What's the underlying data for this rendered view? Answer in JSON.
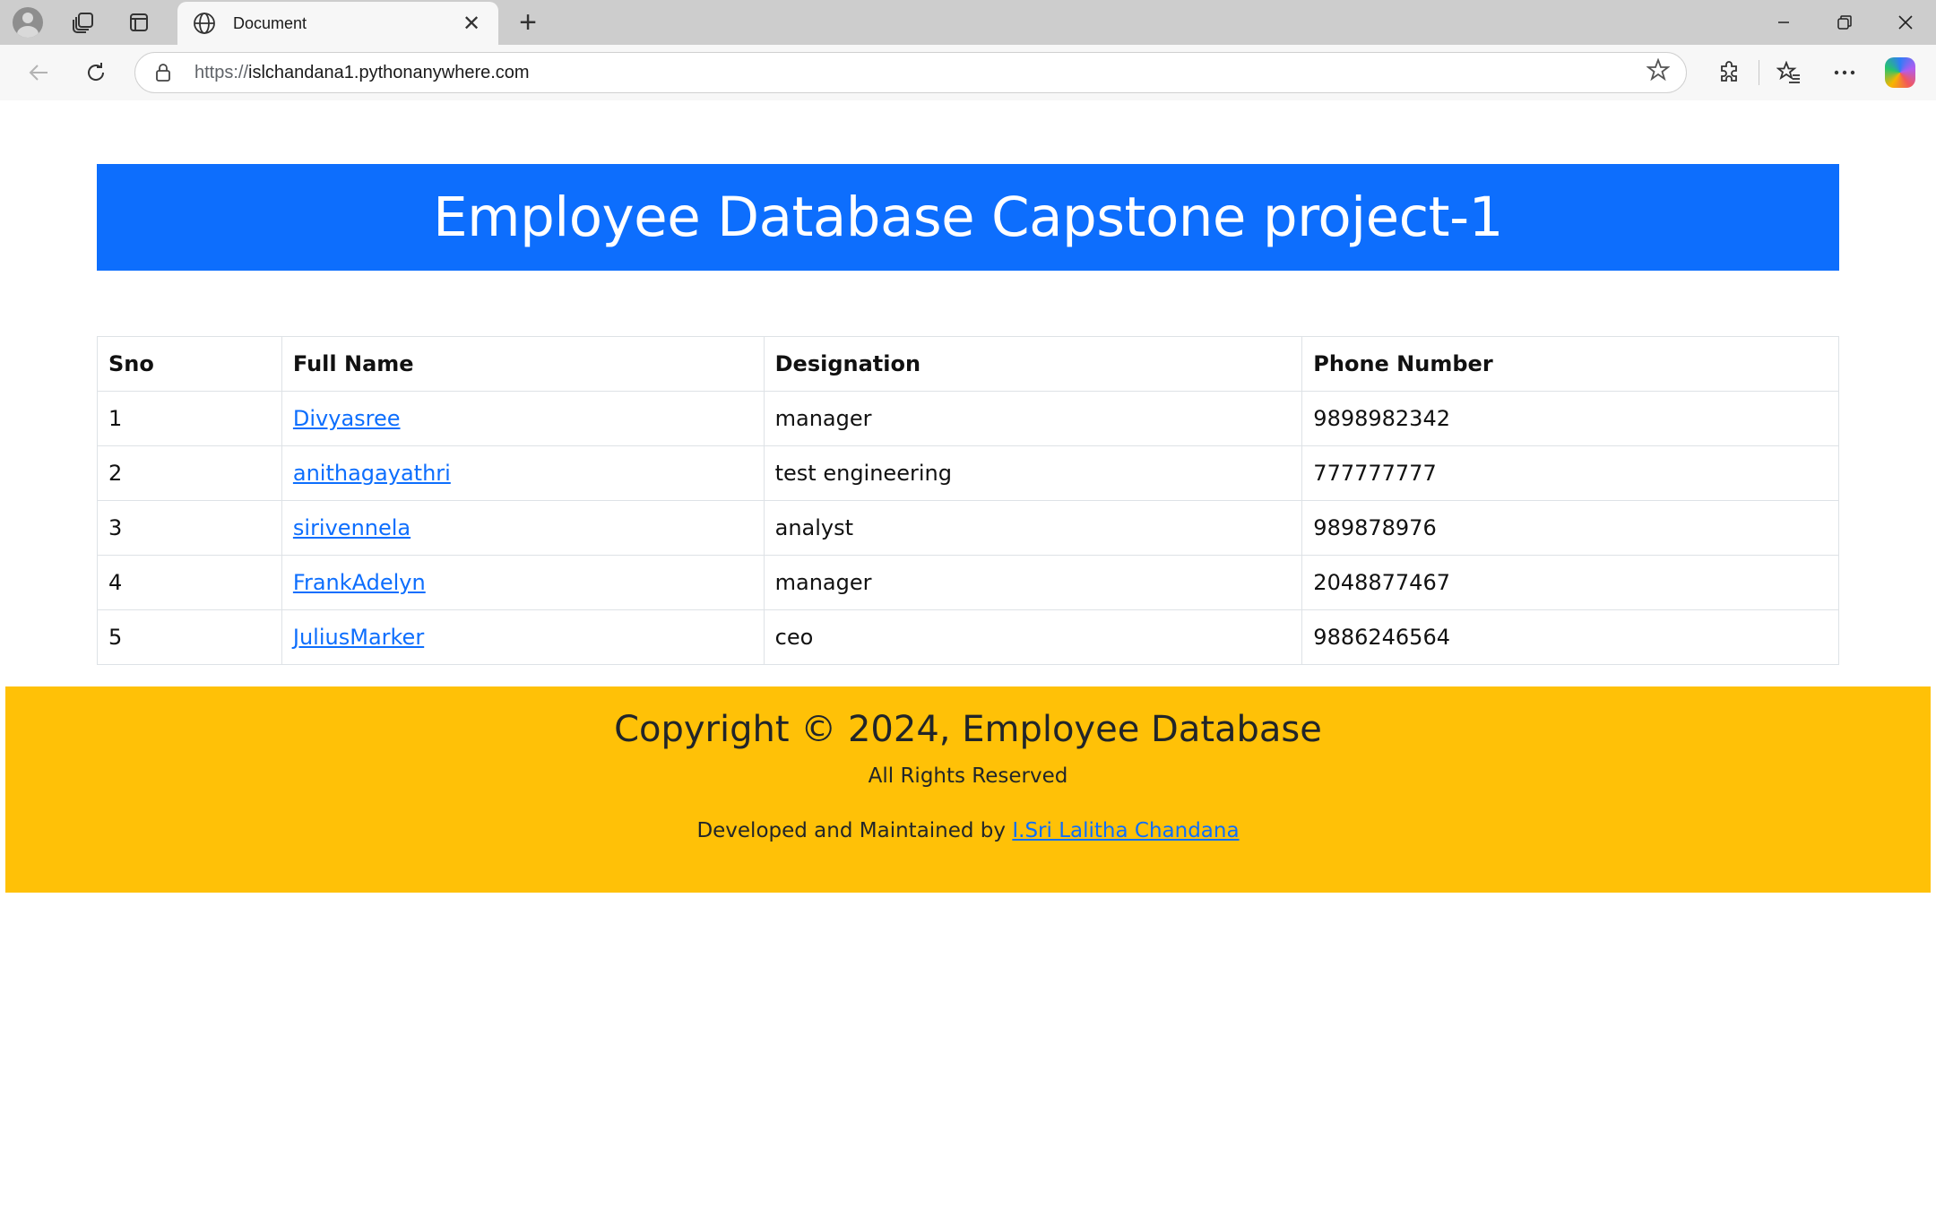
{
  "browser": {
    "tab_title": "Document",
    "url_protocol": "https://",
    "url_host": "islchandana1.pythonanywhere.com",
    "icons": [
      "profile-avatar-icon",
      "workspaces-icon",
      "tab-actions-icon",
      "globe-icon",
      "close-icon",
      "plus-icon",
      "minimize-icon",
      "restore-icon",
      "window-close-icon",
      "back-icon",
      "refresh-icon",
      "lock-icon",
      "star-icon",
      "extensions-icon",
      "favorites-icon",
      "more-icon",
      "copilot-icon"
    ]
  },
  "page": {
    "header_title": "Employee Database Capstone project-1",
    "header_color": "#0d6efd",
    "table": {
      "columns": [
        "Sno",
        "Full Name",
        "Designation",
        "Phone Number"
      ],
      "rows": [
        {
          "sno": "1",
          "name": "Divyasree",
          "designation": "manager",
          "phone": "9898982342"
        },
        {
          "sno": "2",
          "name": "anithagayathri",
          "designation": "test engineering",
          "phone": "777777777"
        },
        {
          "sno": "3",
          "name": "sirivennela",
          "designation": "analyst",
          "phone": "989878976"
        },
        {
          "sno": "4",
          "name": "FrankAdelyn",
          "designation": "manager",
          "phone": "2048877467"
        },
        {
          "sno": "5",
          "name": "JuliusMarker",
          "designation": "ceo",
          "phone": "9886246564"
        }
      ]
    },
    "footer": {
      "copyright": "Copyright © 2024, Employee Database",
      "rights": "All Rights Reserved",
      "developed_prefix": "Developed and Maintained by",
      "developer_name": "I.Sri Lalitha Chandana",
      "background_color": "#ffc107"
    }
  }
}
